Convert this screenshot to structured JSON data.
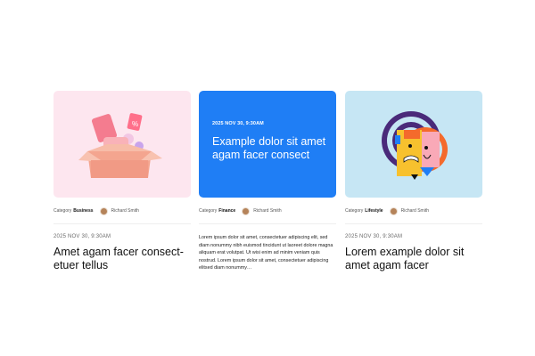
{
  "cards": [
    {
      "image_icon": "gift-box-discount-illustration",
      "category_label": "Category",
      "category": "Business",
      "author": "Richard Smith",
      "date": "2025 NOV 30, 9:30AM",
      "title": "Amet agam facer consect-etuer tellus",
      "colors": {
        "thumb_bg": "#fde6ef"
      }
    },
    {
      "featured_date": "2025 NOV 30, 9:30AM",
      "featured_title": "Example dolor sit amet agam facer consect",
      "category_label": "Category",
      "category": "Finance",
      "author": "Richard Smith",
      "excerpt": "Lorem ipsum dolor sit amet, consectetuer adipiscing elit, sed diam nonummy nibh euismod tincidunt ut laoreet dolore magna aliquam erat volutpat. Ut wisi enim ad minim veniam quis nostrud. Lorem ipsum dolor sit amet, consectetuer adipiscing elitsed diam nonummy…",
      "colors": {
        "thumb_bg": "#1f7ef5"
      }
    },
    {
      "image_icon": "abstract-face-illustration",
      "category_label": "Category",
      "category": "Lifestyle",
      "author": "Richard Smith",
      "date": "2025 NOV 30, 9:30AM",
      "title": "Lorem example dolor sit amet agam facer",
      "colors": {
        "thumb_bg": "#c6e6f4"
      }
    }
  ],
  "avatar_icon": "author-avatar"
}
